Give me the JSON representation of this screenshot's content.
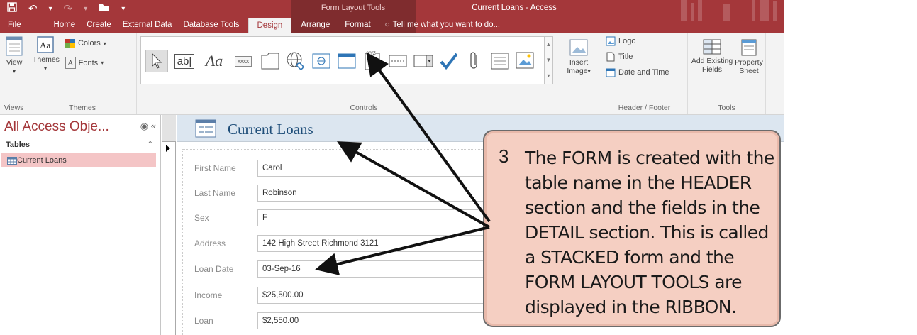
{
  "quick_access": {
    "save_icon": "save-icon",
    "undo_icon": "undo-icon",
    "redo_icon": "redo-icon",
    "open_icon": "open-folder-icon",
    "customize_icon": "customize-qat-icon"
  },
  "title_bar": {
    "contextual_group": "Form Layout Tools",
    "window_title": "Current Loans - Access",
    "accent_color": "#a4373a"
  },
  "tabs": [
    "File",
    "Home",
    "Create",
    "External Data",
    "Database Tools",
    "Design",
    "Arrange",
    "Format"
  ],
  "active_tab": "Design",
  "tell_me": "Tell me what you want to do...",
  "ribbon": {
    "views": {
      "label": "Views",
      "view_button": "View"
    },
    "themes": {
      "label": "Themes",
      "themes_button": "Themes",
      "colors": "Colors",
      "fonts": "Fonts"
    },
    "controls": {
      "label": "Controls",
      "label_control_text": "Aa",
      "textbox_text": "ab|",
      "button_text": "xxxx"
    },
    "insert_image": {
      "line1": "Insert",
      "line2": "Image"
    },
    "header_footer": {
      "label": "Header / Footer",
      "logo": "Logo",
      "title": "Title",
      "date_time": "Date and Time"
    },
    "tools": {
      "label": "Tools",
      "add_existing_line1": "Add Existing",
      "add_existing_line2": "Fields",
      "property_line1": "Property",
      "property_line2": "Sheet"
    }
  },
  "nav_pane": {
    "title": "All Access Obje...",
    "section": "Tables",
    "items": [
      "Current Loans"
    ]
  },
  "form": {
    "header_title": "Current Loans",
    "fields": [
      {
        "label": "First Name",
        "value": "Carol"
      },
      {
        "label": "Last Name",
        "value": "Robinson"
      },
      {
        "label": "Sex",
        "value": "F"
      },
      {
        "label": "Address",
        "value": "142 High Street Richmond 3121"
      },
      {
        "label": "Loan Date",
        "value": "03-Sep-16"
      },
      {
        "label": "Income",
        "value": "$25,500.00"
      },
      {
        "label": "Loan",
        "value": "$2,550.00"
      }
    ]
  },
  "callout": {
    "number": "3",
    "text": "The FORM is created with the table name in the HEADER section and the fields in the DETAIL section.  This is called a STACKED form and the FORM LAYOUT TOOLS are displayed in the RIBBON."
  }
}
